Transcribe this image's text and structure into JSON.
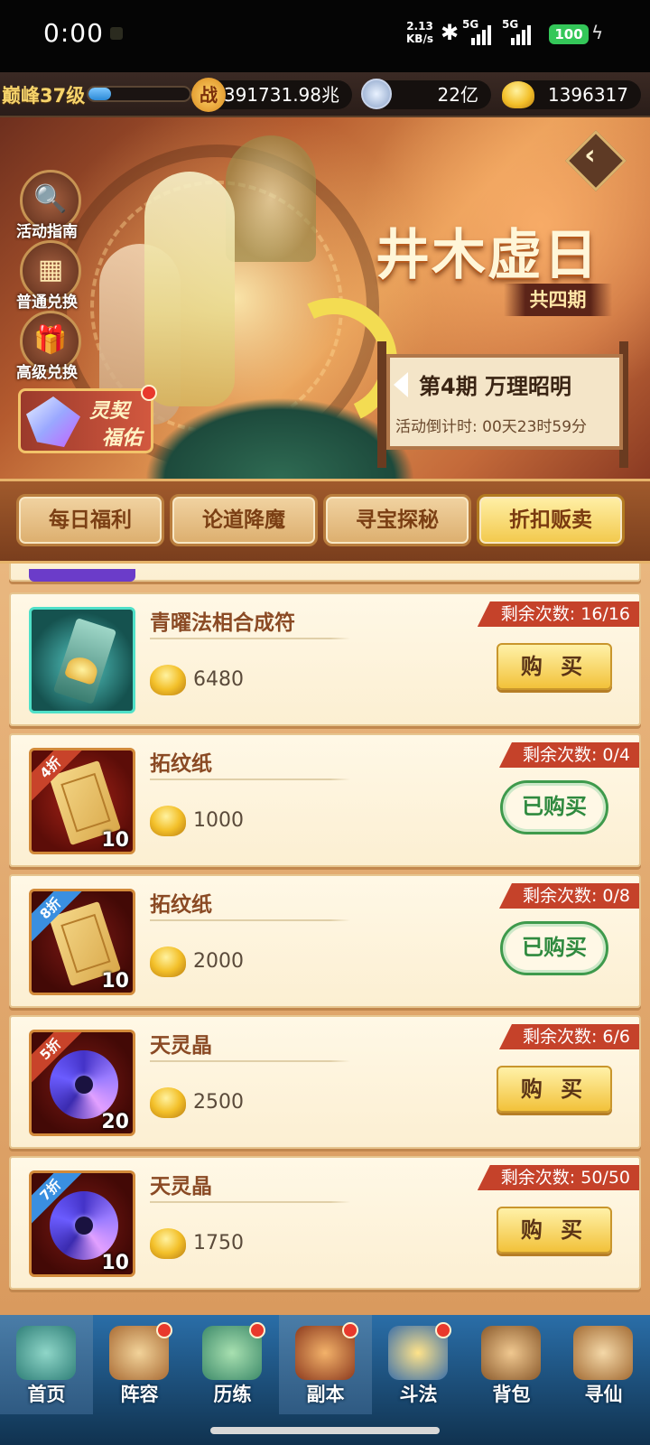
{
  "status_bar": {
    "time": "0:00",
    "net_speed_value": "2.13",
    "net_speed_unit": "KB/s",
    "signal_label_1": "5G",
    "signal_label_2": "5G",
    "battery": "100"
  },
  "resources": {
    "level": "巅峰37级",
    "xp_fill_fraction": 0.22,
    "power_icon_text": "战",
    "power": "391731.98兆",
    "copper": "22亿",
    "ingots": "1396317"
  },
  "banner": {
    "title": "井木虚日",
    "subtitle": "共四期",
    "side_buttons": [
      {
        "label": "活动指南",
        "icon": "magnifier-icon",
        "glyph": "🔍"
      },
      {
        "label": "普通兑换",
        "icon": "box-icon",
        "glyph": "▦"
      },
      {
        "label": "高级兑换",
        "icon": "gift-icon",
        "glyph": "🎁"
      }
    ],
    "lingqi_line1": "灵契",
    "lingqi_line2": "福佑",
    "period_title": "第4期  万理昭明",
    "countdown": "活动倒计时: 00天23时59分"
  },
  "tabs": [
    "每日福利",
    "论道降魔",
    "寻宝探秘",
    "折扣贩卖"
  ],
  "active_tab": 3,
  "items": [
    {
      "name": "青曜法相合成符",
      "price": "6480",
      "remain": "剩余次数: 16/16",
      "action": "购 买",
      "bought": false,
      "discount": "",
      "qty": "",
      "icon": "talisman"
    },
    {
      "name": "拓纹纸",
      "price": "1000",
      "remain": "剩余次数: 0/4",
      "action": "已购买",
      "bought": true,
      "discount": "4折",
      "qty": "10",
      "icon": "paper"
    },
    {
      "name": "拓纹纸",
      "price": "2000",
      "remain": "剩余次数: 0/8",
      "action": "已购买",
      "bought": true,
      "discount": "8折",
      "qty": "10",
      "icon": "paper"
    },
    {
      "name": "天灵晶",
      "price": "2500",
      "remain": "剩余次数: 6/6",
      "action": "购 买",
      "bought": false,
      "discount": "5折",
      "qty": "20",
      "icon": "crystal"
    },
    {
      "name": "天灵晶",
      "price": "1750",
      "remain": "剩余次数: 50/50",
      "action": "购 买",
      "bought": false,
      "discount": "7折",
      "qty": "10",
      "icon": "crystal"
    }
  ],
  "nav": [
    {
      "label": "首页",
      "dot": false,
      "active": true
    },
    {
      "label": "阵容",
      "dot": true,
      "active": false
    },
    {
      "label": "历练",
      "dot": true,
      "active": false
    },
    {
      "label": "副本",
      "dot": true,
      "active": true
    },
    {
      "label": "斗法",
      "dot": true,
      "active": false
    },
    {
      "label": "背包",
      "dot": false,
      "active": false
    },
    {
      "label": "寻仙",
      "dot": false,
      "active": false
    }
  ],
  "colors": {
    "accent_gold": "#f2c23a",
    "remain_red": "#c5422a",
    "bought_green": "#3e9a4c",
    "discount_red": "#c8432a",
    "discount_blue": "#3a8fe0"
  }
}
